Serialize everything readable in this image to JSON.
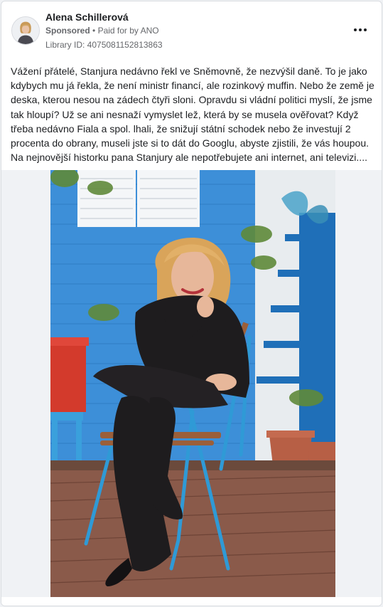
{
  "advertiser": {
    "name": "Alena Schillerová",
    "sponsored_label": "Sponsored",
    "paid_for_by": "Paid for by ANO",
    "separator": "•",
    "library_id": "Library ID: 4075081152813863"
  },
  "post": {
    "text": "Vážení přátelé, Stanjura nedávno řekl ve Sněmovně, že nezvýšil daně. To je jako kdybych mu já řekla, že není ministr financí, ale rozinkový muffin. Nebo že země je deska, kterou nesou na zádech čtyři sloni. Opravdu si vládní politici myslí, že jsme tak hloupí? Už se ani nesnaží vymyslet lež, která by se musela ověřovat? Když třeba nedávno Fiala a spol. lhali, že snižují státní schodek nebo že investují 2 procenta do obrany, museli jste si to dát do Googlu, abyste zjistili, že vás houpou. Na nejnovější historku pana Stanjury ale nepotřebujete ani internet, ani televizi...."
  },
  "icons": {
    "options": "more-horizontal-icon"
  },
  "colors": {
    "wall_blue": "#3d8fd8",
    "deck_brown": "#8a5a4a",
    "chair_blue": "#2f9ad6",
    "outfit_black": "#1e1c1e",
    "hair_blonde": "#d9a45a"
  }
}
